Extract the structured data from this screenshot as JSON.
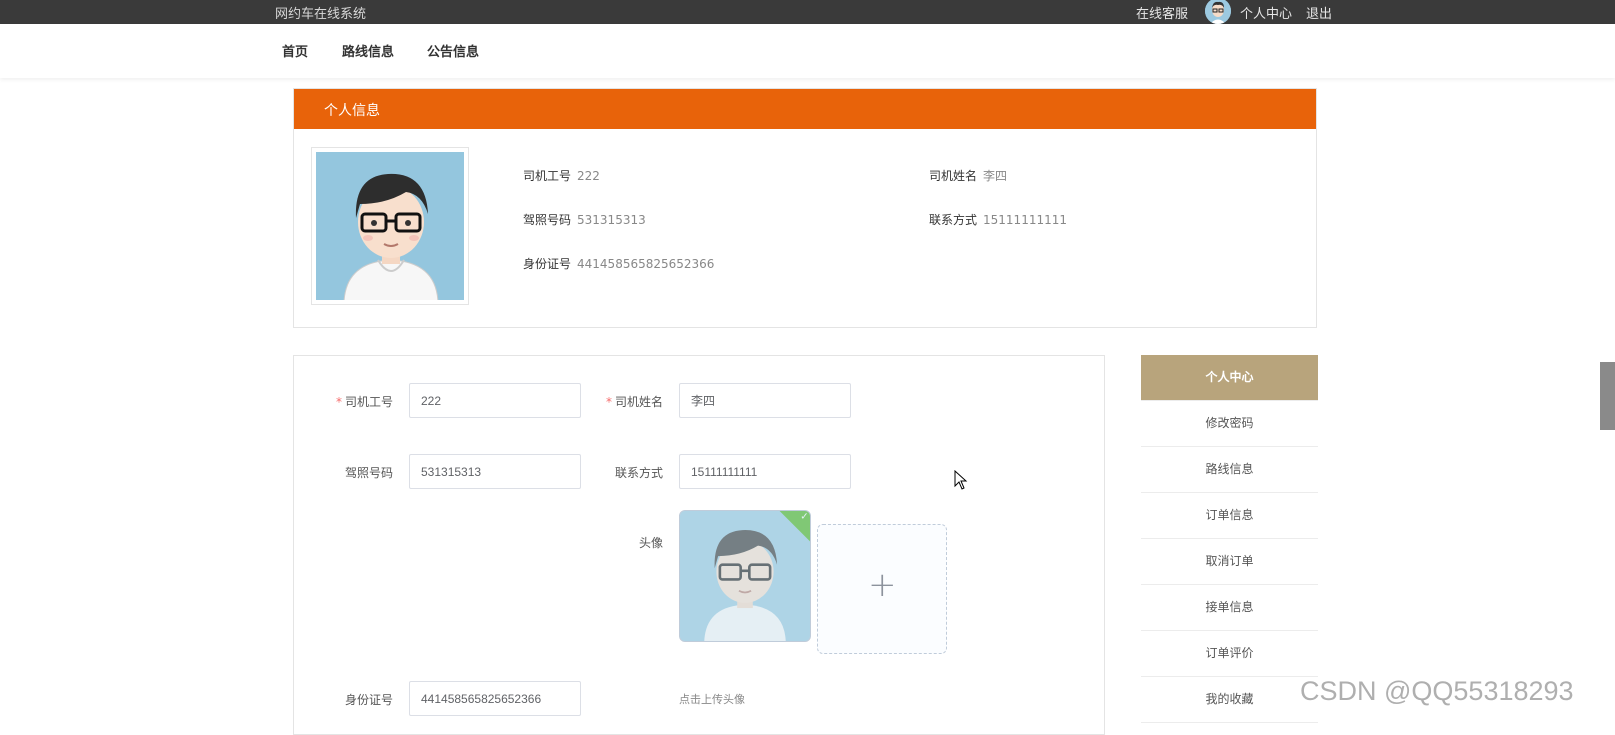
{
  "topbar": {
    "site_title": "网约车在线系统",
    "online_service": "在线客服",
    "user_center": "个人中心",
    "logout": "退出"
  },
  "nav": {
    "items": [
      "首页",
      "路线信息",
      "公告信息"
    ]
  },
  "profile": {
    "header": "个人信息",
    "driver_id_label": "司机工号",
    "driver_id": "222",
    "driver_name_label": "司机姓名",
    "driver_name": "李四",
    "license_label": "驾照号码",
    "license": "531315313",
    "contact_label": "联系方式",
    "contact": "15111111111",
    "id_card_label": "身份证号",
    "id_card": "441458565825652366"
  },
  "form": {
    "required_mark": "*",
    "driver_id_label": "司机工号",
    "driver_id_value": "222",
    "driver_name_label": "司机姓名",
    "driver_name_value": "李四",
    "license_label": "驾照号码",
    "license_value": "531315313",
    "contact_label": "联系方式",
    "contact_value": "15111111111",
    "avatar_label": "头像",
    "id_card_label": "身份证号",
    "id_card_value": "441458565825652366",
    "upload_tip": "点击上传头像"
  },
  "side_menu": {
    "items": [
      "个人中心",
      "修改密码",
      "路线信息",
      "订单信息",
      "取消订单",
      "接单信息",
      "订单评价",
      "我的收藏"
    ],
    "active_index": 0
  },
  "watermark": "CSDN @QQ55318293",
  "colors": {
    "topbar": "#3a3a3a",
    "header_accent": "#e8630a",
    "side_active": "#b8a47c",
    "required": "#f56c6c"
  }
}
